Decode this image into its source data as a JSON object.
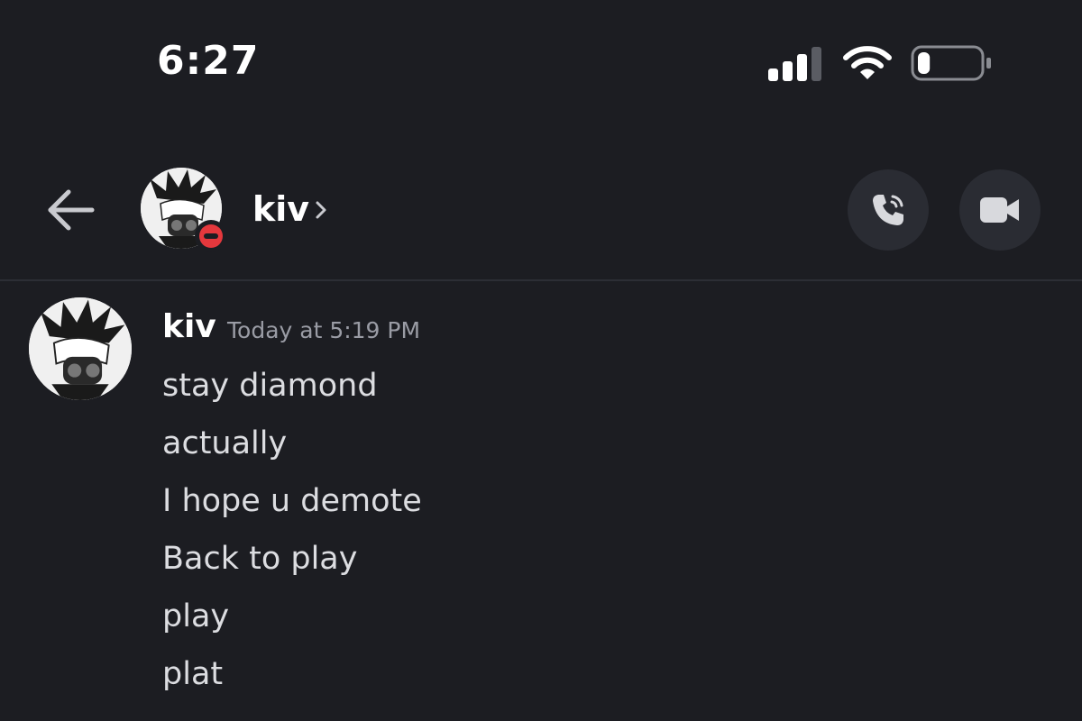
{
  "status_bar": {
    "time": "6:27",
    "signal_icon": "cellular-signal-icon",
    "wifi_icon": "wifi-icon",
    "battery_icon": "battery-icon",
    "battery_level": 0.2
  },
  "header": {
    "back_icon": "arrow-left-icon",
    "avatar_icon": "user-avatar",
    "status": "do-not-disturb",
    "status_color": "#e5383d",
    "name": "kiv",
    "chevron_icon": "chevron-right-icon",
    "call_icon": "phone-icon",
    "video_icon": "video-camera-icon"
  },
  "message_group": {
    "author": "kiv",
    "timestamp": "Today at 5:19 PM",
    "lines": [
      "stay diamond",
      "actually",
      "I hope u demote",
      "Back to play",
      "play",
      "plat"
    ]
  },
  "colors": {
    "background": "#1c1d22",
    "button_bg": "#2a2c33",
    "text_primary": "#ffffff",
    "text_message": "#dcdde1",
    "text_muted": "#9a9ca5"
  }
}
